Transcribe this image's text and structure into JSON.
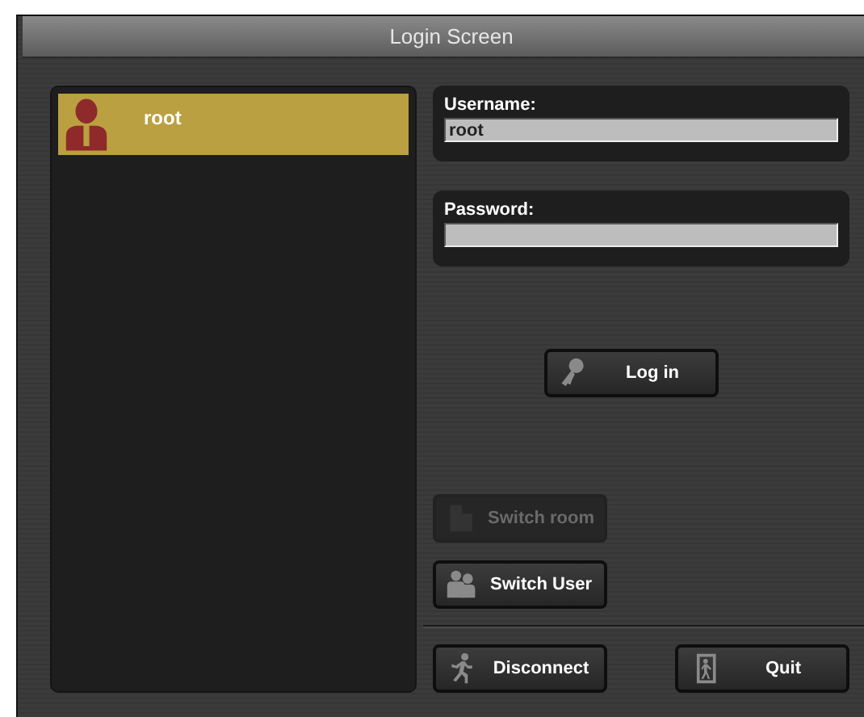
{
  "window": {
    "title": "Login Screen"
  },
  "users": [
    {
      "name": "root",
      "selected": true
    }
  ],
  "fields": [
    {
      "label": "Username:",
      "value": "root"
    },
    {
      "label": "Password:"
    }
  ],
  "login_button": {
    "label": "Log in",
    "kind": "key"
  },
  "side_buttons": [
    {
      "label": "Switch room",
      "kind": "room",
      "disabled": true
    },
    {
      "label": "Switch User",
      "kind": "users",
      "disabled": false
    }
  ],
  "bottom_buttons": [
    {
      "label": "Disconnect",
      "kind": "runner",
      "disabled": false
    },
    {
      "label": "Quit",
      "kind": "exit",
      "disabled": false
    }
  ]
}
